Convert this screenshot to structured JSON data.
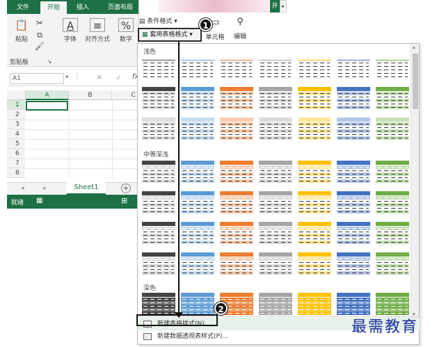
{
  "tabs": {
    "file": "文件",
    "home": "开始",
    "insert": "插入",
    "page_layout": "页面布局",
    "more": "开"
  },
  "ribbon": {
    "paste": "粘贴",
    "clipboard_group": "剪贴板",
    "font": "字体",
    "alignment": "对齐方式",
    "number": "数字",
    "number_icon": "%",
    "font_icon": "A",
    "conditional_format": "条件格式",
    "format_as_table": "套用表格格式",
    "cells": "单元格",
    "editing": "编辑"
  },
  "formula_bar": {
    "name_box": "A1",
    "fx": "fx"
  },
  "grid": {
    "columns": [
      "A",
      "B",
      "C"
    ],
    "rows": [
      "1",
      "2",
      "3",
      "4",
      "5",
      "6",
      "7",
      "8"
    ]
  },
  "sheet": {
    "tab": "Sheet1",
    "add": "+"
  },
  "status": {
    "text": "就绪"
  },
  "gallery": {
    "light_label": "浅色",
    "medium_label": "中等深浅",
    "dark_label": "深色",
    "new_table_style": "新建表格样式(N)...",
    "new_pivot_style": "新建数据透视表样式(P)...",
    "colors": [
      "#444444",
      "#5b9bd5",
      "#ed7d31",
      "#a5a5a5",
      "#ffc000",
      "#4472c4",
      "#70ad47"
    ],
    "light_colors": [
      "#dddddd",
      "#c6dcf1",
      "#f8cbad",
      "#dbdbdb",
      "#ffe699",
      "#b4c6e7",
      "#c6e0b4"
    ]
  },
  "callouts": {
    "step1": "1",
    "step2": "2"
  },
  "watermark": "最需教育"
}
